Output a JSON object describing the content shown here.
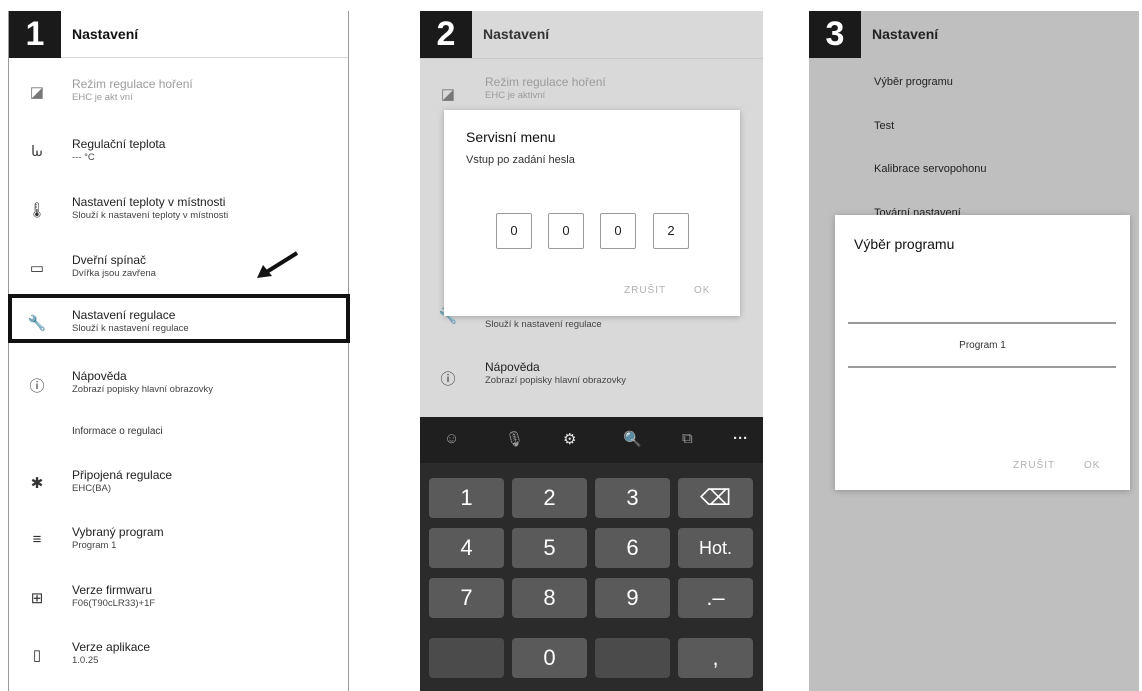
{
  "panel1": {
    "badge": "1",
    "title": "Nastavení",
    "items": [
      {
        "icon": "brightness-icon",
        "glyph": "◪",
        "title": "Režim regulace hoření",
        "subtitle": "EHC je akt vní",
        "disabled": true
      },
      {
        "icon": "flame-icon",
        "glyph": "ᘈ",
        "title": "Regulační teplota",
        "subtitle": "--- °C"
      },
      {
        "icon": "thermometer-icon",
        "glyph": "🌡",
        "title": "Nastavení teploty v místnosti",
        "subtitle": "Slouží k nastavení teploty v místnosti"
      },
      {
        "icon": "door-icon",
        "glyph": "▭",
        "title": "Dveřní spínač",
        "subtitle": "Dvířka jsou zavřena"
      },
      {
        "icon": "wrench-icon",
        "glyph": "🔧",
        "title": "Nastavení regulace",
        "subtitle": "Slouží k nastavení regulace"
      },
      {
        "icon": "info-icon",
        "glyph": "ⓘ",
        "title": "Nápověda",
        "subtitle": "Zobrazí popisky hlavní obrazovky"
      }
    ],
    "section_label": "Informace o regulaci",
    "info_items": [
      {
        "icon": "bluetooth-icon",
        "glyph": "✱",
        "title": "Připojená regulace",
        "subtitle": "EHC(BA)"
      },
      {
        "icon": "list-check-icon",
        "glyph": "≡",
        "title": "Vybraný program",
        "subtitle": "Program 1"
      },
      {
        "icon": "chip-icon",
        "glyph": "⊞",
        "title": "Verze firmwaru",
        "subtitle": "F06(T90cLR33)+1F"
      },
      {
        "icon": "phone-icon",
        "glyph": "▯",
        "title": "Verze aplikace",
        "subtitle": "1.0.25"
      }
    ]
  },
  "panel2": {
    "badge": "2",
    "title": "Nastavení",
    "bg_items": [
      {
        "title": "Režim regulace hoření",
        "subtitle": "EHC je aktivní"
      },
      {
        "title": "",
        "subtitle": "Slouží k nastavení regulace"
      },
      {
        "title": "Nápověda",
        "subtitle": "Zobrazí popisky hlavní obrazovky"
      }
    ],
    "dialog": {
      "title": "Servisní menu",
      "subtitle": "Vstup po zadání hesla",
      "pin": [
        "0",
        "0",
        "0",
        "2"
      ],
      "cancel": "ZRUŠIT",
      "ok": "OK"
    },
    "keyboard": {
      "toolbar": [
        "☺",
        "🎙",
        "⚙",
        "🔍",
        "⧉",
        "···"
      ],
      "keys": [
        "1",
        "2",
        "3",
        "⌫",
        "4",
        "5",
        "6",
        "Hot.",
        "7",
        "8",
        "9",
        ".–",
        "",
        "0",
        "",
        ","
      ]
    }
  },
  "panel3": {
    "badge": "3",
    "title": "Nastavení",
    "menu": [
      "Výběr programu",
      "Test",
      "Kalibrace servopohonu",
      "Tovární nastavení"
    ],
    "dialog": {
      "title": "Výběr programu",
      "selected": "Program 1",
      "cancel": "ZRUŠIT",
      "ok": "OK"
    }
  },
  "colors": {
    "badge": "#1a1a1a",
    "keyboard": "#2b2b2b",
    "key": "#5a5a5a",
    "disabled_text": "#9b9b9b"
  }
}
